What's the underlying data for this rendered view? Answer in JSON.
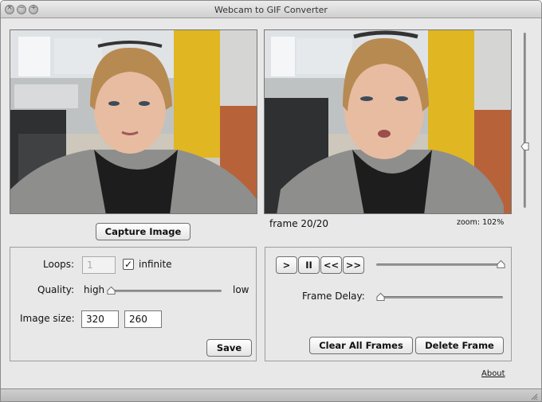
{
  "window": {
    "title": "Webcam to GIF Converter"
  },
  "capture": {
    "button_label": "Capture Image"
  },
  "preview": {
    "frame_label": "frame 20/20",
    "zoom_label": "zoom: 102%",
    "zoom_slider_level": 0.35
  },
  "settings": {
    "loops_label": "Loops:",
    "loops_value": "1",
    "infinite_label": "infinite",
    "infinite_checked": true,
    "quality_label": "Quality:",
    "quality_high": "high",
    "quality_low": "low",
    "quality_level": 0.0,
    "size_label": "Image size:",
    "width_value": "320",
    "height_value": "260",
    "save_label": "Save"
  },
  "playback": {
    "play_label": ">",
    "pause_label": "II",
    "rewind_label": "<<",
    "forward_label": ">>",
    "position_level": 1.0,
    "frame_delay_label": "Frame Delay:",
    "frame_delay_level": 0.0,
    "clear_label": "Clear All Frames",
    "delete_label": "Delete Frame"
  },
  "footer": {
    "about_label": "About"
  }
}
